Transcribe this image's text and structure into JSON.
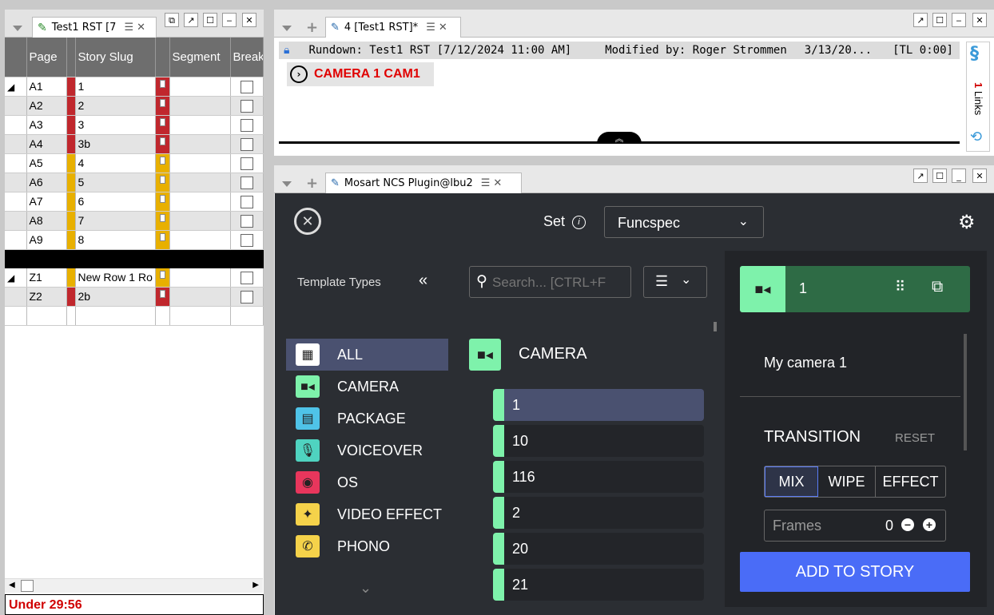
{
  "left_panel": {
    "tab_title": "Test1 RST [7",
    "columns": [
      "Page",
      "Story Slug",
      "Segment",
      "Break"
    ],
    "rows": [
      {
        "page": "A1",
        "slug": "1",
        "color": "red",
        "expand": true
      },
      {
        "page": "A2",
        "slug": "2",
        "color": "red",
        "expand": false
      },
      {
        "page": "A3",
        "slug": "3",
        "color": "red",
        "expand": false
      },
      {
        "page": "A4",
        "slug": "3b",
        "color": "red",
        "expand": false
      },
      {
        "page": "A5",
        "slug": "4",
        "color": "yellow",
        "expand": false
      },
      {
        "page": "A6",
        "slug": "5",
        "color": "yellow",
        "expand": false
      },
      {
        "page": "A7",
        "slug": "6",
        "color": "yellow",
        "expand": false
      },
      {
        "page": "A8",
        "slug": "7",
        "color": "yellow",
        "expand": false
      },
      {
        "page": "A9",
        "slug": "8",
        "color": "yellow",
        "expand": false
      },
      {
        "page": "Z1",
        "slug": "New Row 1 Ro",
        "color": "yellow",
        "expand": true
      },
      {
        "page": "Z2",
        "slug": "2b",
        "color": "red",
        "expand": false
      }
    ],
    "status": "Under 29:56"
  },
  "story_panel": {
    "tab_title": "4 [Test1 RST]*",
    "header_rundown": "Rundown: Test1 RST [7/12/2024 11:00 AM]",
    "header_modified": "Modified by: Roger Strommen",
    "header_date": "3/13/20...",
    "header_tl": "[TL 0:00]",
    "camera_text": "CAMERA 1 CAM1",
    "links_count": "1",
    "links_label": "Links"
  },
  "plugin_panel": {
    "tab_title": "Mosart NCS Plugin@lbu2",
    "set_label": "Set",
    "set_value": "Funcspec",
    "template_types_label": "Template Types",
    "search_placeholder": "Search... [CTRL+F",
    "categories": [
      {
        "label": "ALL",
        "icon": "grid-icon",
        "color": "#ffffff"
      },
      {
        "label": "CAMERA",
        "icon": "camera-icon",
        "color": "#7ef2ab"
      },
      {
        "label": "PACKAGE",
        "icon": "film-icon",
        "color": "#4fc3e8"
      },
      {
        "label": "VOICEOVER",
        "icon": "voiceover-icon",
        "color": "#4fd3c0"
      },
      {
        "label": "OS",
        "icon": "record-icon",
        "color": "#e8365c"
      },
      {
        "label": "VIDEO EFFECT",
        "icon": "effect-icon",
        "color": "#f5d24a"
      },
      {
        "label": "PHONO",
        "icon": "phone-icon",
        "color": "#f5d24a"
      }
    ],
    "list_header": "CAMERA",
    "list_items": [
      "1",
      "10",
      "116",
      "2",
      "20",
      "21"
    ],
    "selected_item": "1",
    "detail_title": "1",
    "detail_name": "My camera 1",
    "transition_label": "TRANSITION",
    "reset_label": "RESET",
    "transition_options": [
      "MIX",
      "WIPE",
      "EFFECT"
    ],
    "frames_label": "Frames",
    "frames_value": "0",
    "add_button": "ADD TO STORY",
    "colors": {
      "accent_blue": "#4a6cf7",
      "camera_green": "#7ef2ab",
      "header_green": "#2e6b45",
      "selected_row": "#4a5170"
    }
  }
}
